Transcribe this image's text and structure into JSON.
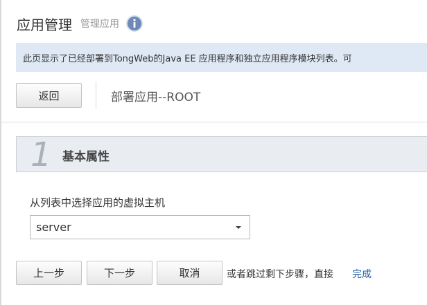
{
  "header": {
    "title": "应用管理",
    "subtitle": "管理应用",
    "info_icon": "info-icon"
  },
  "info_banner": {
    "text": "此页显示了已经部署到TongWeb的Java EE 应用程序和独立应用程序模块列表。可"
  },
  "toolbar": {
    "back_label": "返回",
    "deploy_label": "部署应用--ROOT"
  },
  "step": {
    "number": "1",
    "title": "基本属性"
  },
  "form": {
    "vhost_label": "从列表中选择应用的虚拟主机",
    "vhost_selected": "server"
  },
  "actions": {
    "prev_label": "上一步",
    "next_label": "下一步",
    "cancel_label": "取消",
    "skip_text": "或者跳过剩下步骤，直接",
    "finish_label": "完成"
  },
  "colors": {
    "banner_bg": "#dfe9f5",
    "info_icon": "#6e89b7",
    "link": "#1a5aa6",
    "step_number": "#a9b1bb"
  }
}
